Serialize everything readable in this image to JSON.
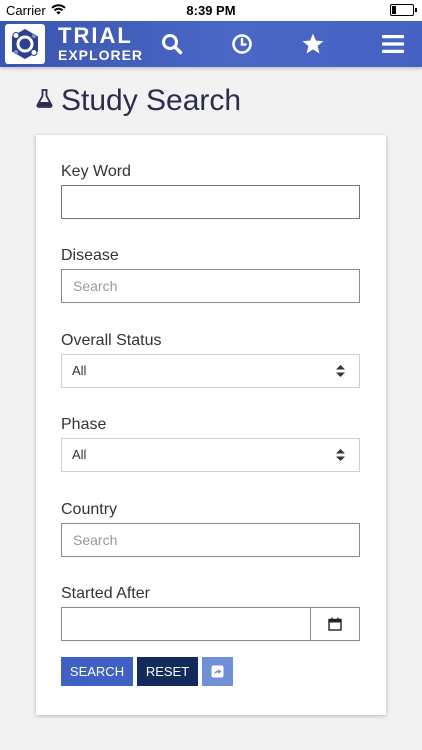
{
  "status_bar": {
    "carrier": "Carrier",
    "time": "8:39 PM",
    "battery_level": 0.2
  },
  "navbar": {
    "brand_title": "TRIAL",
    "brand_subtitle": "EXPLORER",
    "icons": [
      "logo-icon",
      "search-icon",
      "history-clock-icon",
      "star-icon",
      "hamburger-menu-icon"
    ],
    "accent_color": "#3f61c4"
  },
  "page": {
    "title": "Study Search",
    "title_icon": "flask-icon"
  },
  "form": {
    "keyword": {
      "label": "Key Word",
      "value": ""
    },
    "disease": {
      "label": "Disease",
      "placeholder": "Search"
    },
    "overall_status": {
      "label": "Overall Status",
      "selected": "All"
    },
    "phase": {
      "label": "Phase",
      "selected": "All"
    },
    "country": {
      "label": "Country",
      "placeholder": "Search"
    },
    "started_after": {
      "label": "Started After",
      "value": "",
      "icon": "calendar-icon"
    }
  },
  "buttons": {
    "search": "SEARCH",
    "reset": "RESET",
    "share_icon": "share-icon"
  }
}
